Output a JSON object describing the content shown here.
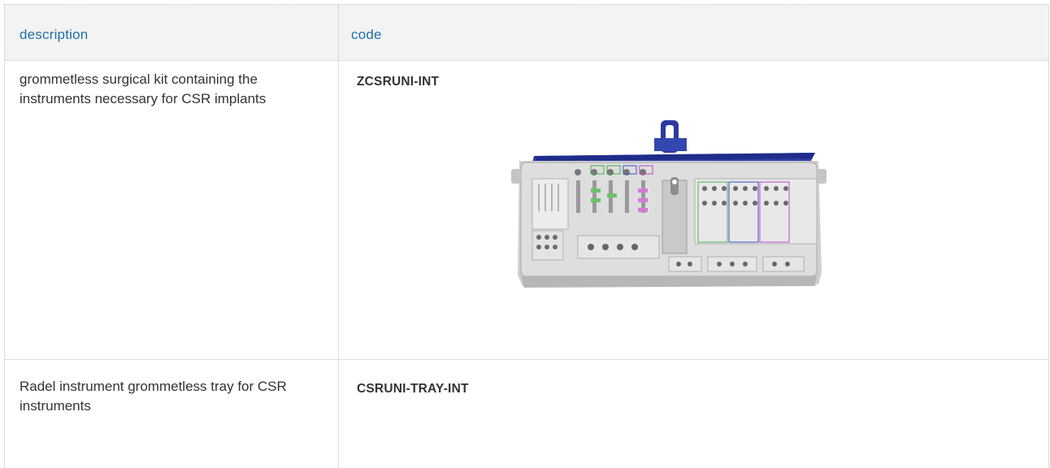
{
  "table": {
    "headers": {
      "description": "description",
      "code": "code"
    },
    "rows": [
      {
        "description": "grommetless surgical kit containing the instruments necessary for CSR implants",
        "code": "ZCSRUNI-INT",
        "image": "surgical-kit-tray"
      },
      {
        "description": "Radel instrument grommetless tray for CSR instruments",
        "code": "CSRUNI-TRAY-INT"
      }
    ]
  },
  "colors": {
    "header_text": "#1f6fa8",
    "header_bg": "#f3f3f3",
    "border": "#bdbdbd",
    "body_text": "#333333",
    "kit_lid": "#2b3aa0",
    "kit_tray": "#d9d9d9"
  }
}
